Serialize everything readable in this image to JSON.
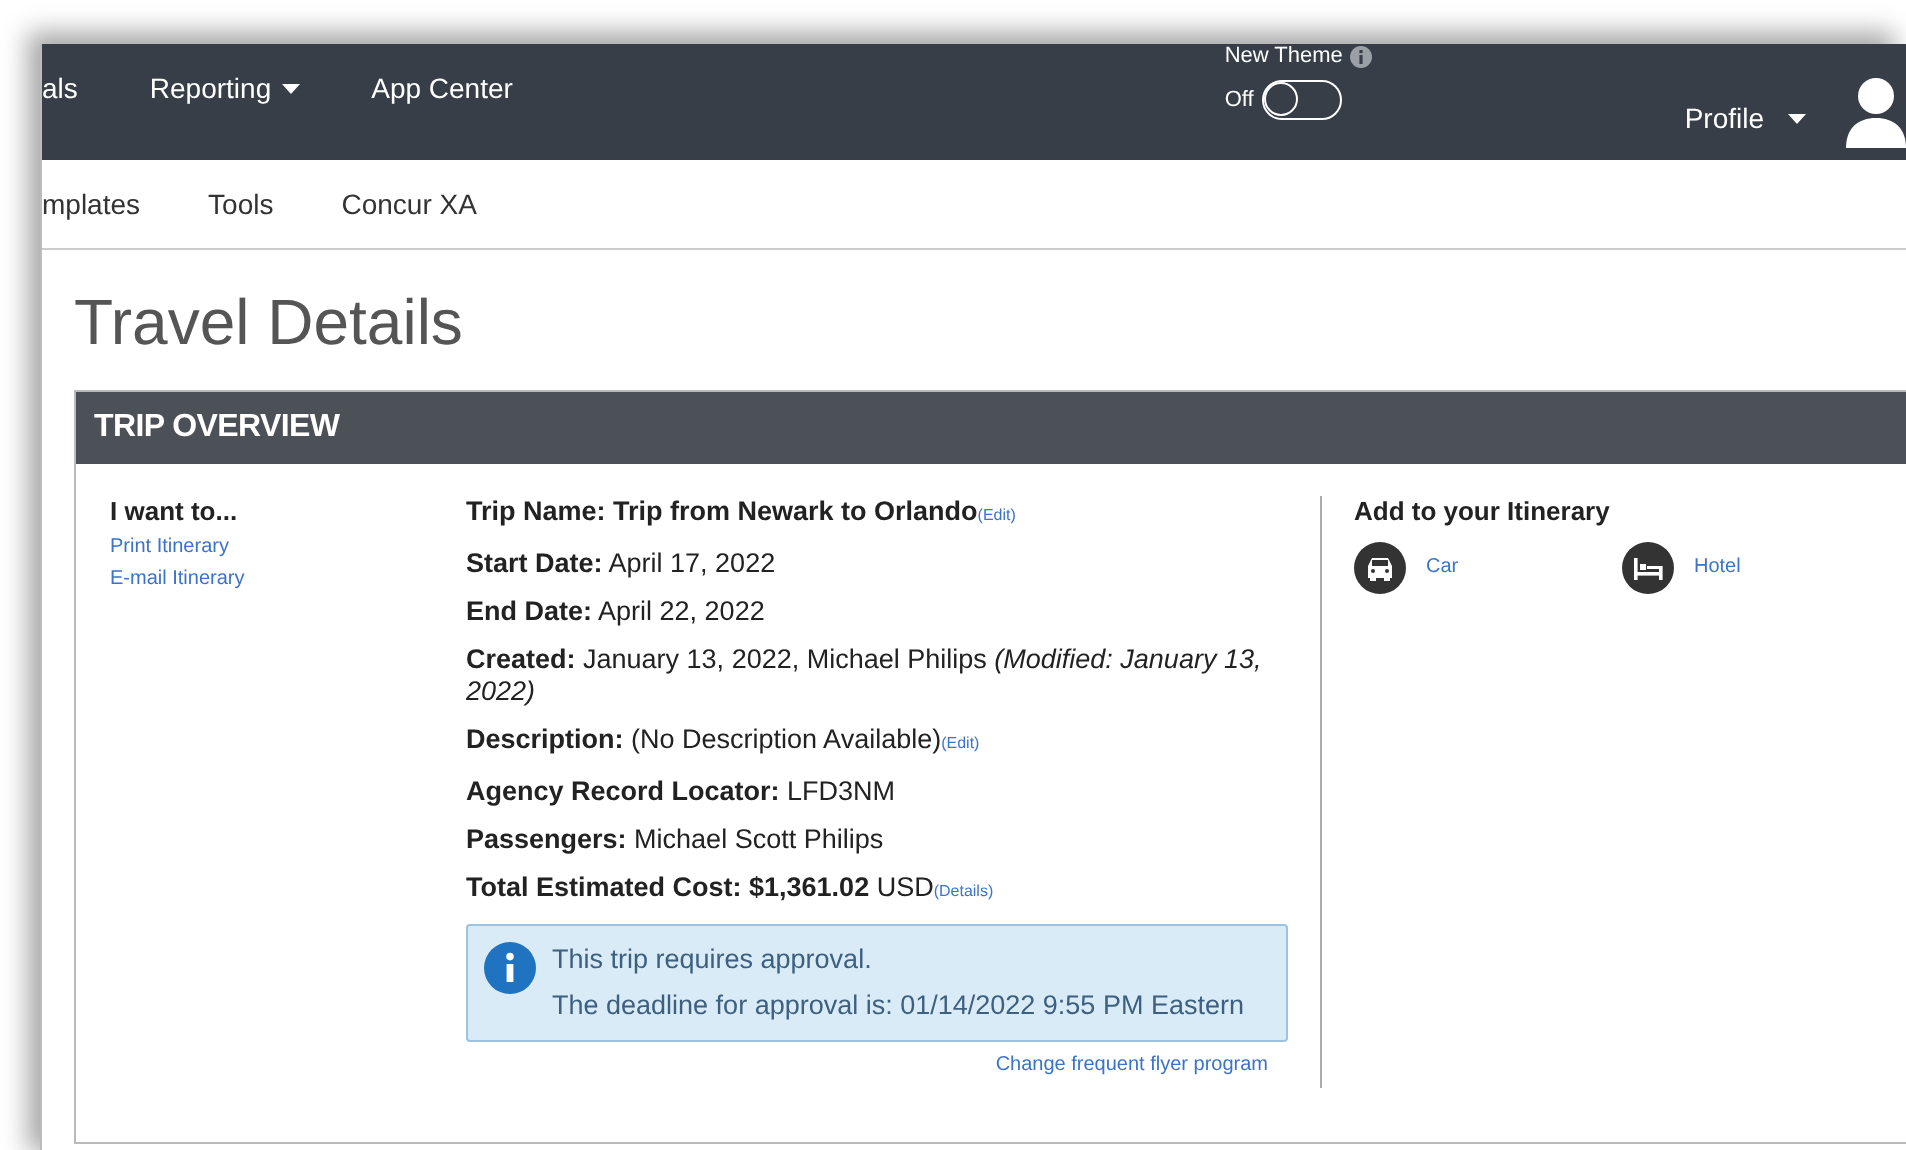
{
  "top_nav": {
    "items": [
      {
        "label": "als",
        "dropdown": false
      },
      {
        "label": "Reporting",
        "dropdown": true
      },
      {
        "label": "App Center",
        "dropdown": false
      }
    ],
    "theme_toggle": {
      "label": "New Theme",
      "state_label": "Off",
      "on": false
    },
    "profile": {
      "label": "Profile"
    }
  },
  "sub_nav": {
    "items": [
      {
        "label": "mplates"
      },
      {
        "label": "Tools"
      },
      {
        "label": "Concur XA"
      }
    ]
  },
  "page_title": "Travel Details",
  "trip_overview": {
    "header": "TRIP OVERVIEW",
    "actions": {
      "heading": "I want to...",
      "links": [
        "Print Itinerary",
        "E-mail Itinerary"
      ]
    },
    "details": [
      {
        "text": "**Trip Name: Trip from Newark to Orlando**",
        "link": "(Edit)"
      },
      {
        "text": "**Start Date:** April 17, 2022"
      },
      {
        "text": "**End Date:** April 22, 2022"
      },
      {
        "text": "**Created:** January 13, 2022, Michael Philips *(Modified: January 13, 2022)*"
      },
      {
        "text": "**Description:** (No Description Available)",
        "link": "(Edit)"
      },
      {
        "text": "**Agency Record Locator:** LFD3NM"
      },
      {
        "text": "**Passengers:** Michael Scott Philips"
      },
      {
        "text": "**Total Estimated Cost: $1,361.02** USD",
        "link": "(Details)"
      }
    ],
    "notice": {
      "lines": [
        "This trip requires approval.",
        "The deadline for approval is: 01/14/2022 9:55 PM Eastern"
      ]
    },
    "footer_link": "Change frequent flyer program",
    "add_to_itinerary": {
      "heading": "Add to your Itinerary",
      "items": [
        {
          "kind": "car",
          "label": "Car"
        },
        {
          "kind": "hotel",
          "label": "Hotel"
        }
      ]
    }
  }
}
